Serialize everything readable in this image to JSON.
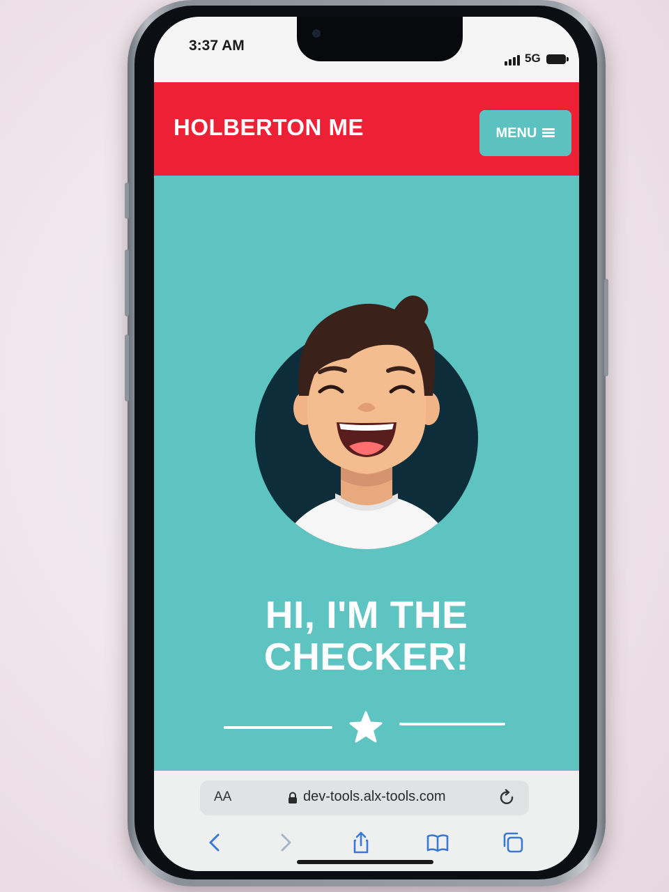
{
  "status_bar": {
    "time": "3:37 AM",
    "network": "5G"
  },
  "site": {
    "brand": "HOLBERTON ME",
    "menu_label": "MENU"
  },
  "hero": {
    "line1": "HI, I'M THE",
    "line2": "CHECKER!",
    "avatar_icon": "smiling-person-avatar",
    "divider_icon": "star-icon"
  },
  "browser": {
    "text_size_label": "AA",
    "url": "dev-tools.alx-tools.com",
    "toolbar_icons": [
      "back-icon",
      "forward-icon",
      "share-icon",
      "bookmarks-icon",
      "tabs-icon"
    ]
  },
  "colors": {
    "header_red": "#ee2035",
    "hero_teal": "#5dc4c2",
    "menu_button": "#5cc2c1",
    "text_white": "#ffffff"
  }
}
